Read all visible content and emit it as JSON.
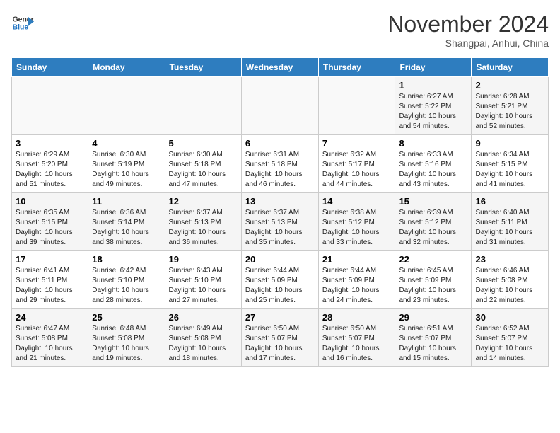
{
  "header": {
    "logo_line1": "General",
    "logo_line2": "Blue",
    "month": "November 2024",
    "location": "Shangpai, Anhui, China"
  },
  "weekdays": [
    "Sunday",
    "Monday",
    "Tuesday",
    "Wednesday",
    "Thursday",
    "Friday",
    "Saturday"
  ],
  "weeks": [
    [
      {
        "day": "",
        "info": ""
      },
      {
        "day": "",
        "info": ""
      },
      {
        "day": "",
        "info": ""
      },
      {
        "day": "",
        "info": ""
      },
      {
        "day": "",
        "info": ""
      },
      {
        "day": "1",
        "info": "Sunrise: 6:27 AM\nSunset: 5:22 PM\nDaylight: 10 hours and 54 minutes."
      },
      {
        "day": "2",
        "info": "Sunrise: 6:28 AM\nSunset: 5:21 PM\nDaylight: 10 hours and 52 minutes."
      }
    ],
    [
      {
        "day": "3",
        "info": "Sunrise: 6:29 AM\nSunset: 5:20 PM\nDaylight: 10 hours and 51 minutes."
      },
      {
        "day": "4",
        "info": "Sunrise: 6:30 AM\nSunset: 5:19 PM\nDaylight: 10 hours and 49 minutes."
      },
      {
        "day": "5",
        "info": "Sunrise: 6:30 AM\nSunset: 5:18 PM\nDaylight: 10 hours and 47 minutes."
      },
      {
        "day": "6",
        "info": "Sunrise: 6:31 AM\nSunset: 5:18 PM\nDaylight: 10 hours and 46 minutes."
      },
      {
        "day": "7",
        "info": "Sunrise: 6:32 AM\nSunset: 5:17 PM\nDaylight: 10 hours and 44 minutes."
      },
      {
        "day": "8",
        "info": "Sunrise: 6:33 AM\nSunset: 5:16 PM\nDaylight: 10 hours and 43 minutes."
      },
      {
        "day": "9",
        "info": "Sunrise: 6:34 AM\nSunset: 5:15 PM\nDaylight: 10 hours and 41 minutes."
      }
    ],
    [
      {
        "day": "10",
        "info": "Sunrise: 6:35 AM\nSunset: 5:15 PM\nDaylight: 10 hours and 39 minutes."
      },
      {
        "day": "11",
        "info": "Sunrise: 6:36 AM\nSunset: 5:14 PM\nDaylight: 10 hours and 38 minutes."
      },
      {
        "day": "12",
        "info": "Sunrise: 6:37 AM\nSunset: 5:13 PM\nDaylight: 10 hours and 36 minutes."
      },
      {
        "day": "13",
        "info": "Sunrise: 6:37 AM\nSunset: 5:13 PM\nDaylight: 10 hours and 35 minutes."
      },
      {
        "day": "14",
        "info": "Sunrise: 6:38 AM\nSunset: 5:12 PM\nDaylight: 10 hours and 33 minutes."
      },
      {
        "day": "15",
        "info": "Sunrise: 6:39 AM\nSunset: 5:12 PM\nDaylight: 10 hours and 32 minutes."
      },
      {
        "day": "16",
        "info": "Sunrise: 6:40 AM\nSunset: 5:11 PM\nDaylight: 10 hours and 31 minutes."
      }
    ],
    [
      {
        "day": "17",
        "info": "Sunrise: 6:41 AM\nSunset: 5:11 PM\nDaylight: 10 hours and 29 minutes."
      },
      {
        "day": "18",
        "info": "Sunrise: 6:42 AM\nSunset: 5:10 PM\nDaylight: 10 hours and 28 minutes."
      },
      {
        "day": "19",
        "info": "Sunrise: 6:43 AM\nSunset: 5:10 PM\nDaylight: 10 hours and 27 minutes."
      },
      {
        "day": "20",
        "info": "Sunrise: 6:44 AM\nSunset: 5:09 PM\nDaylight: 10 hours and 25 minutes."
      },
      {
        "day": "21",
        "info": "Sunrise: 6:44 AM\nSunset: 5:09 PM\nDaylight: 10 hours and 24 minutes."
      },
      {
        "day": "22",
        "info": "Sunrise: 6:45 AM\nSunset: 5:09 PM\nDaylight: 10 hours and 23 minutes."
      },
      {
        "day": "23",
        "info": "Sunrise: 6:46 AM\nSunset: 5:08 PM\nDaylight: 10 hours and 22 minutes."
      }
    ],
    [
      {
        "day": "24",
        "info": "Sunrise: 6:47 AM\nSunset: 5:08 PM\nDaylight: 10 hours and 21 minutes."
      },
      {
        "day": "25",
        "info": "Sunrise: 6:48 AM\nSunset: 5:08 PM\nDaylight: 10 hours and 19 minutes."
      },
      {
        "day": "26",
        "info": "Sunrise: 6:49 AM\nSunset: 5:08 PM\nDaylight: 10 hours and 18 minutes."
      },
      {
        "day": "27",
        "info": "Sunrise: 6:50 AM\nSunset: 5:07 PM\nDaylight: 10 hours and 17 minutes."
      },
      {
        "day": "28",
        "info": "Sunrise: 6:50 AM\nSunset: 5:07 PM\nDaylight: 10 hours and 16 minutes."
      },
      {
        "day": "29",
        "info": "Sunrise: 6:51 AM\nSunset: 5:07 PM\nDaylight: 10 hours and 15 minutes."
      },
      {
        "day": "30",
        "info": "Sunrise: 6:52 AM\nSunset: 5:07 PM\nDaylight: 10 hours and 14 minutes."
      }
    ]
  ]
}
